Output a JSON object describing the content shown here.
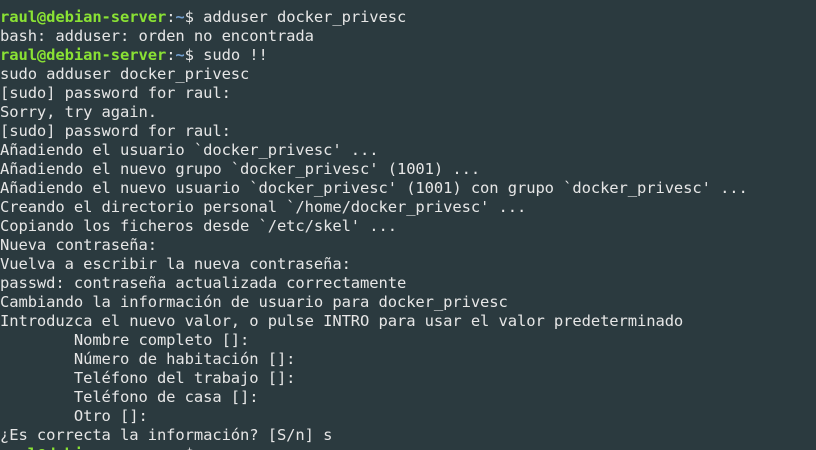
{
  "terminal": {
    "prompt": {
      "user_host": "raul@debian-server",
      "sep": ":",
      "path": "~",
      "symbol": "$ "
    },
    "lines": [
      {
        "kind": "prompt",
        "command": "adduser docker_privesc"
      },
      {
        "kind": "output",
        "text": "bash: adduser: orden no encontrada"
      },
      {
        "kind": "prompt",
        "command": "sudo !!"
      },
      {
        "kind": "output",
        "text": "sudo adduser docker_privesc"
      },
      {
        "kind": "output",
        "text": "[sudo] password for raul:"
      },
      {
        "kind": "output",
        "text": "Sorry, try again."
      },
      {
        "kind": "output",
        "text": "[sudo] password for raul:"
      },
      {
        "kind": "output",
        "text": "Añadiendo el usuario `docker_privesc' ..."
      },
      {
        "kind": "output",
        "text": "Añadiendo el nuevo grupo `docker_privesc' (1001) ..."
      },
      {
        "kind": "output",
        "text": "Añadiendo el nuevo usuario `docker_privesc' (1001) con grupo `docker_privesc' ..."
      },
      {
        "kind": "output",
        "text": "Creando el directorio personal `/home/docker_privesc' ..."
      },
      {
        "kind": "output",
        "text": "Copiando los ficheros desde `/etc/skel' ..."
      },
      {
        "kind": "output",
        "text": "Nueva contraseña:"
      },
      {
        "kind": "output",
        "text": "Vuelva a escribir la nueva contraseña:"
      },
      {
        "kind": "output",
        "text": "passwd: contraseña actualizada correctamente"
      },
      {
        "kind": "output",
        "text": "Cambiando la información de usuario para docker_privesc"
      },
      {
        "kind": "output",
        "text": "Introduzca el nuevo valor, o pulse INTRO para usar el valor predeterminado"
      },
      {
        "kind": "output",
        "text": "        Nombre completo []:"
      },
      {
        "kind": "output",
        "text": "        Número de habitación []:"
      },
      {
        "kind": "output",
        "text": "        Teléfono del trabajo []:"
      },
      {
        "kind": "output",
        "text": "        Teléfono de casa []:"
      },
      {
        "kind": "output",
        "text": "        Otro []:"
      },
      {
        "kind": "output",
        "text": "¿Es correcta la información? [S/n] s"
      },
      {
        "kind": "prompt-cut",
        "command": ""
      }
    ]
  },
  "colors": {
    "background": "#2b3a3f",
    "text": "#e6e6e6",
    "user_host": "#8ae234",
    "path": "#729fcf"
  }
}
